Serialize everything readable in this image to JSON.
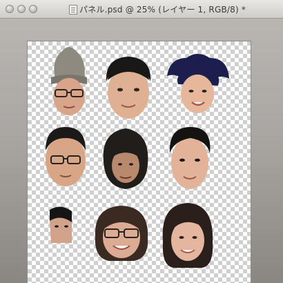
{
  "window": {
    "title": "パネル.psd @ 25% (レイヤー 1, RGB/8) *",
    "controls": [
      "close",
      "minimize",
      "zoom"
    ]
  },
  "canvas": {
    "background": "transparency-checkerboard",
    "layers": [
      {
        "name": "face-1",
        "hair": "#8e8a80",
        "skin": "#d9a58a",
        "accessory": "knit-beanie-and-glasses"
      },
      {
        "name": "face-2",
        "hair": "#1a1816",
        "skin": "#e0b092",
        "accessory": "none"
      },
      {
        "name": "face-3",
        "hair": "#1c1f4e",
        "skin": "#e6b79b",
        "accessory": "navy-hat"
      },
      {
        "name": "face-4",
        "hair": "#1b1a19",
        "skin": "#d8a587",
        "accessory": "glasses"
      },
      {
        "name": "face-5",
        "hair": "#201d1a",
        "skin": "#b9896d",
        "accessory": "long-curly-hair"
      },
      {
        "name": "face-6",
        "hair": "#141312",
        "skin": "#e2b299",
        "accessory": "none"
      },
      {
        "name": "face-7",
        "hair": "#161515",
        "skin": "#d3a28a",
        "accessory": "partial"
      },
      {
        "name": "face-8",
        "hair": "#3a2a22",
        "skin": "#dcab93",
        "accessory": "glasses"
      },
      {
        "name": "face-9",
        "hair": "#2a1f1a",
        "skin": "#e4b6a0",
        "accessory": "none"
      }
    ]
  }
}
